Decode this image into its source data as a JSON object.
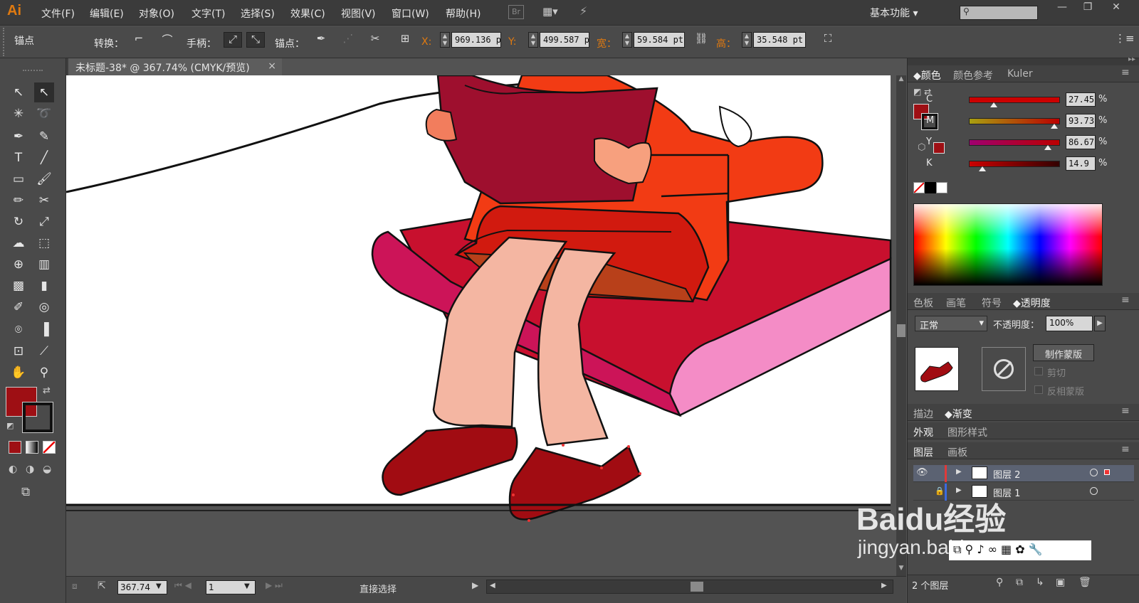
{
  "app": {
    "logo": "Ai"
  },
  "menu": [
    "文件(F)",
    "编辑(E)",
    "对象(O)",
    "文字(T)",
    "选择(S)",
    "效果(C)",
    "视图(V)",
    "窗口(W)",
    "帮助(H)"
  ],
  "menubar_extras": {
    "br_label": "Br",
    "workspace": "基本功能"
  },
  "control": {
    "tool_name": "锚点",
    "convert_label": "转换：",
    "handle_label": "手柄：",
    "anchor_label": "锚点：",
    "x_label": "X:",
    "x_value": "969.136 p",
    "y_label": "Y:",
    "y_value": "499.587 p",
    "w_label": "宽：",
    "w_value": "59.584 pt",
    "h_label": "高：",
    "h_value": "35.548 pt"
  },
  "document": {
    "tab_title": "未标题-38* @ 367.74% (CMYK/预览)",
    "close": "×"
  },
  "status": {
    "zoom": "367.74",
    "page": "1",
    "tool": "直接选择"
  },
  "color_panel": {
    "tabs": [
      "颜色",
      "颜色参考",
      "Kuler"
    ],
    "channels": [
      {
        "name": "C",
        "value": "27.45",
        "unit": "%",
        "level": 0.2745,
        "color": "#9e0f14"
      },
      {
        "name": "M",
        "value": "93.73",
        "unit": "%",
        "level": 0.9373,
        "color": "#9e0f14"
      },
      {
        "name": "Y",
        "value": "86.67",
        "unit": "%",
        "level": 0.8667,
        "color": "#9e0f14"
      },
      {
        "name": "K",
        "value": "14.9",
        "unit": "%",
        "level": 0.149,
        "color": "#9e0f14"
      }
    ],
    "fill_color": "#9e0f14"
  },
  "transparency_panel": {
    "tabs": [
      "色板",
      "画笔",
      "符号",
      "透明度"
    ],
    "blend_mode": "正常",
    "opacity_label": "不透明度：",
    "opacity_value": "100%",
    "make_mask": "制作蒙版",
    "clip": "剪切",
    "invert_mask": "反相蒙版"
  },
  "stroke_tabs": [
    "描边",
    "渐变"
  ],
  "appearance_tabs": [
    "外观",
    "图形样式"
  ],
  "layers_panel": {
    "tabs": [
      "图层",
      "画板"
    ],
    "layers": [
      {
        "name": "图层 2",
        "color": "#e03a3a"
      },
      {
        "name": "图层 1",
        "color": "#3a6ae0"
      }
    ],
    "count": "2 个图层"
  },
  "watermark": {
    "brand": "Baidu经验",
    "url": "jingyan.baidu.com"
  },
  "colors": {
    "accent": "#e07a10",
    "selection": "#9e0f14"
  }
}
